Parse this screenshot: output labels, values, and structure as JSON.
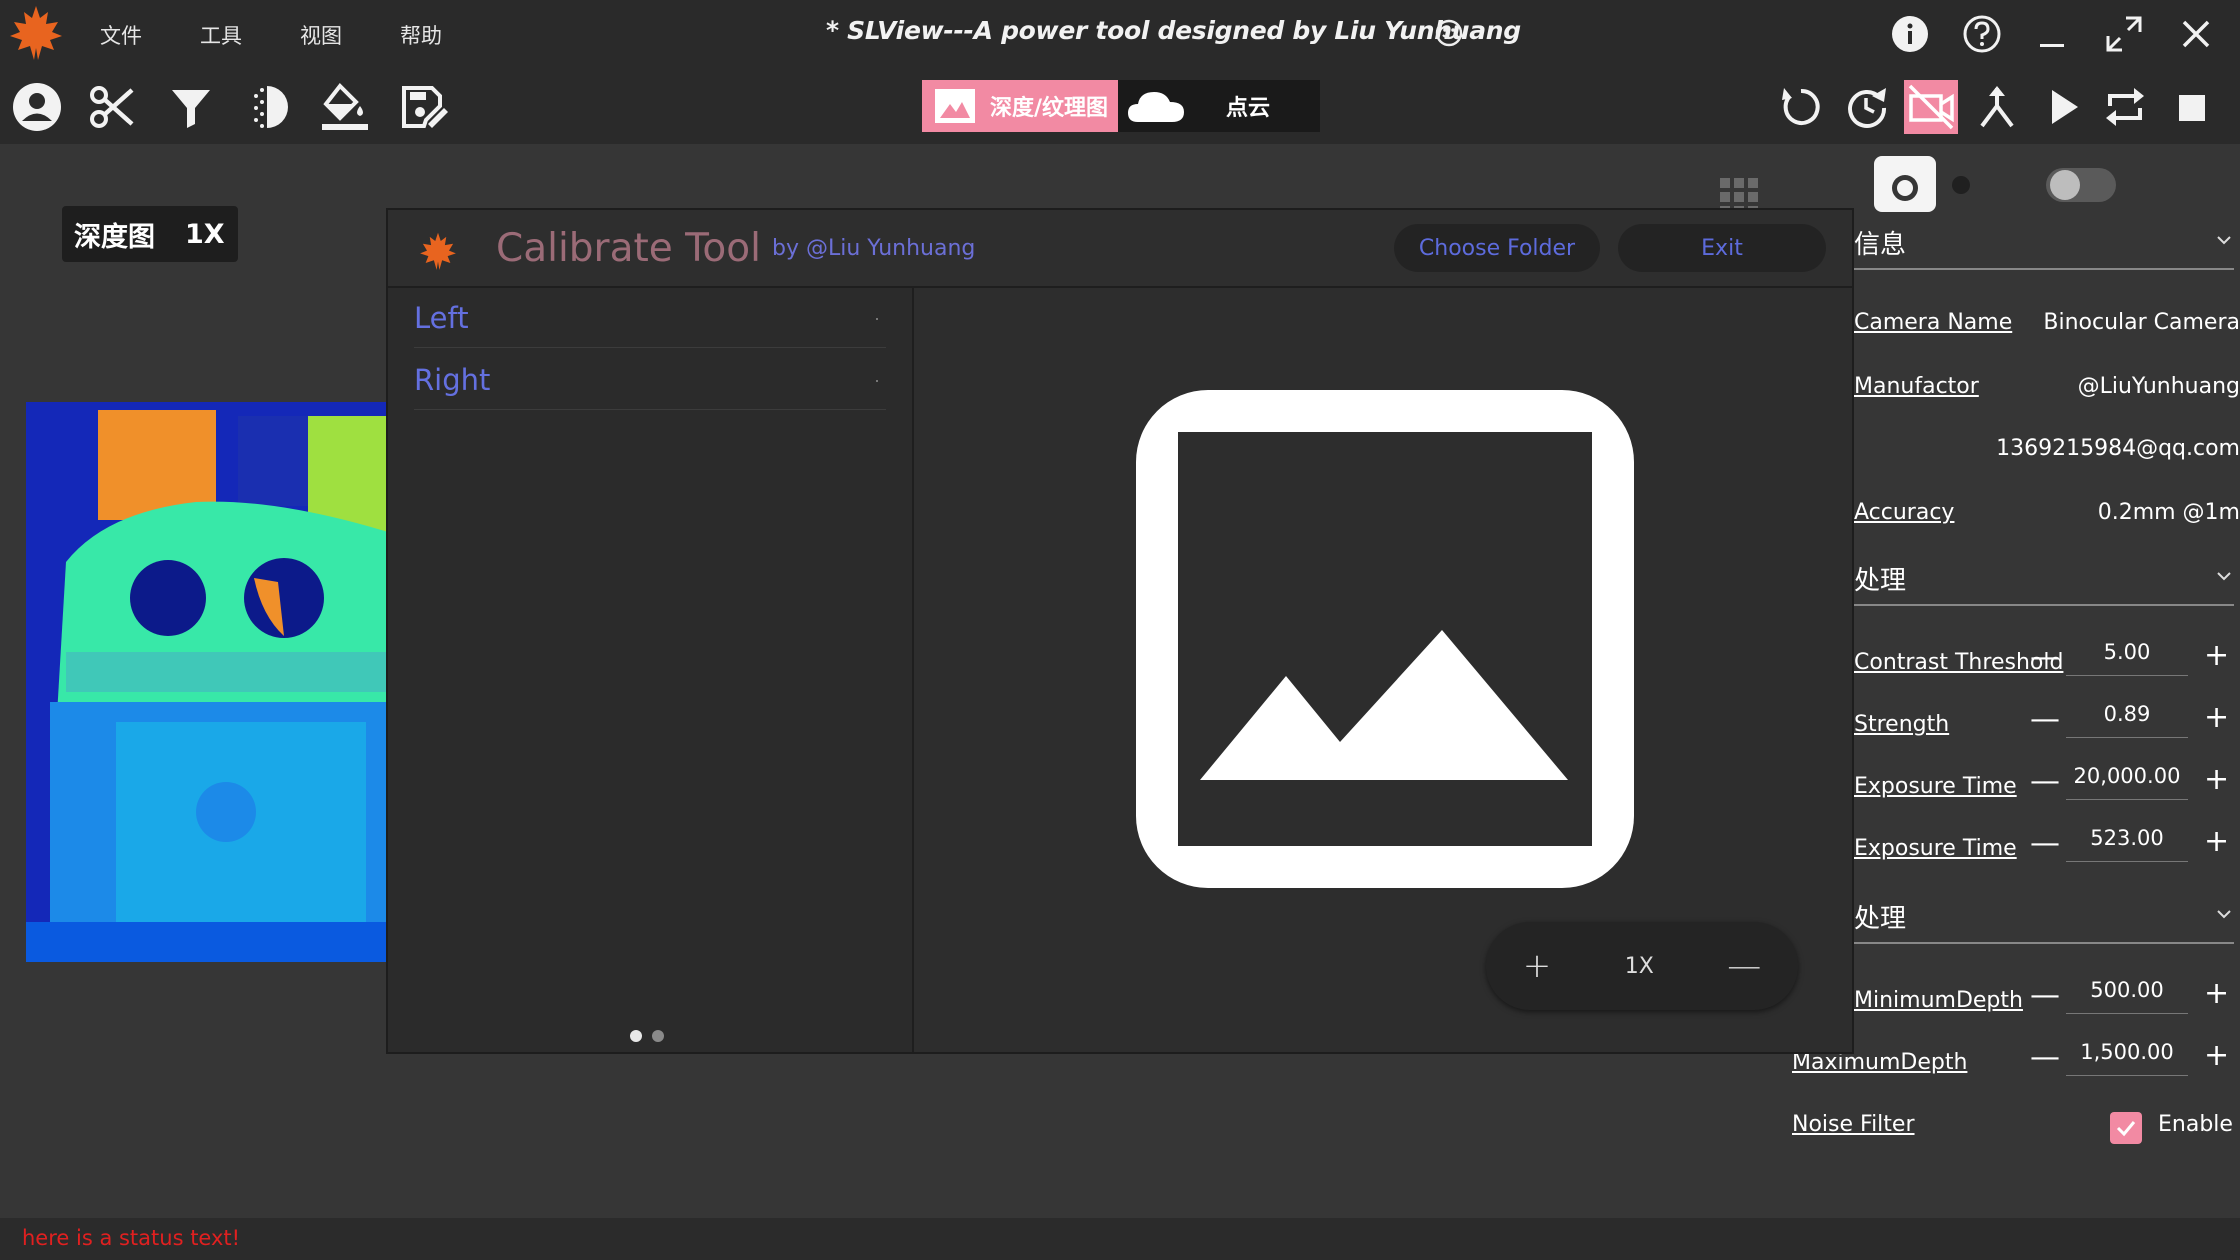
{
  "app": {
    "title": "* SLView---A power tool designed by Liu Yunhuang"
  },
  "menu": [
    "文件",
    "工具",
    "视图",
    "帮助"
  ],
  "mode_switch": {
    "depth_label": "深度/纹理图",
    "cloud_label": "点云",
    "active": "depth",
    "accent": "#f28aa3"
  },
  "view": {
    "label": "深度图",
    "zoom": "1X"
  },
  "dialog": {
    "title": "Calibrate Tool",
    "byline": "by @Liu Yunhuang",
    "choose_folder": "Choose Folder",
    "exit": "Exit",
    "items": [
      "Left",
      "Right"
    ],
    "page_count": 2,
    "page_active": 0,
    "zoom_label": "1X",
    "zoom_plus": "+",
    "zoom_minus": "—"
  },
  "panel": {
    "section1": "信息",
    "camera_name_key": "Camera Name",
    "camera_name_val": "Binocular Camera",
    "manufactor_key": "Manufactor",
    "manufactor_val": "@LiuYunhuang",
    "email_val": "1369215984@qq.com",
    "accuracy_key": "Accuracy",
    "accuracy_val": "0.2mm @1m",
    "section2": "处理",
    "contrast_key": "Contrast Threshold",
    "contrast_val": "5.00",
    "strength_key": "Strength",
    "strength_val": "0.89",
    "exposure_key": "Exposure Time",
    "exposure_val": "20,000.00",
    "exposure2_key": "Exposure Time",
    "exposure2_val": "523.00",
    "section3": "处理",
    "min_depth_key": "MinimumDepth",
    "min_depth_val": "500.00",
    "max_depth_key": "MaximumDepth",
    "max_depth_val": "1,500.00",
    "noise_key": "Noise Filter",
    "noise_enable": "Enable"
  },
  "status": {
    "text": "here is a status text!"
  }
}
